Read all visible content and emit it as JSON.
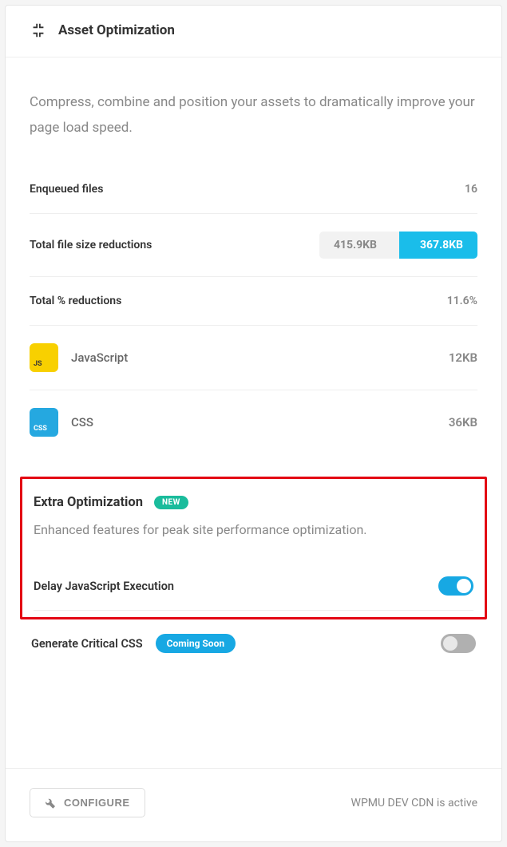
{
  "header": {
    "title": "Asset Optimization"
  },
  "description": "Compress, combine and position your assets to dramatically improve your page load speed.",
  "stats": {
    "enqueued_label": "Enqueued files",
    "enqueued_value": "16",
    "reduction_size_label": "Total file size reductions",
    "reduction_size_before": "415.9KB",
    "reduction_size_after": "367.8KB",
    "reduction_pct_label": "Total % reductions",
    "reduction_pct_value": "11.6%"
  },
  "assets": {
    "js_tag": "JS",
    "js_label": "JavaScript",
    "js_size": "12KB",
    "css_tag": "CSS",
    "css_label": "CSS",
    "css_size": "36KB"
  },
  "extra": {
    "title": "Extra Optimization",
    "new_badge": "NEW",
    "desc": "Enhanced features for peak site performance optimization.",
    "delay_js_label": "Delay JavaScript Execution",
    "delay_js_on": true
  },
  "critical_css": {
    "label": "Generate Critical CSS",
    "badge": "Coming Soon",
    "on": false
  },
  "footer": {
    "configure_label": "CONFIGURE",
    "status": "WPMU DEV CDN is active"
  }
}
